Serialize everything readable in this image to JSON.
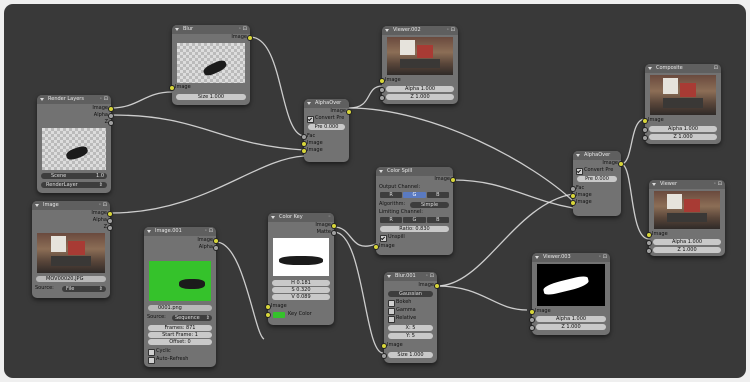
{
  "nodes": {
    "blur_top": {
      "title": "Blur",
      "out_image": "Image",
      "in_image": "Image",
      "size": "Size 1.000"
    },
    "render_layers": {
      "title": "Render Layers",
      "image": "Image",
      "alpha": "Alpha",
      "z": "Z",
      "scene": "Scene",
      "scene_val": "1.0",
      "layer": "RenderLayer"
    },
    "alphaover_1": {
      "title": "AlphaOver",
      "image_out": "Image",
      "convert_pre": "Convert Pre",
      "premul": "Pre 0.000",
      "fac": "Fac",
      "in1": "Image",
      "in2": "Image"
    },
    "viewer_002": {
      "title": "Viewer.002",
      "image": "Image",
      "alpha": "Alpha 1.000",
      "z": "Z 1.000"
    },
    "image_left": {
      "title": "Image",
      "image": "Image",
      "alpha": "Alpha",
      "z": "Z",
      "file": "MOV00020.JPG",
      "source_lbl": "Source:",
      "source_val": "File"
    },
    "image_001": {
      "title": "Image.001",
      "image": "Image",
      "alpha": "Alpha",
      "file": "0001.png",
      "source_lbl": "Source:",
      "source_val": "Sequence",
      "frames": "Frames: 871",
      "start_frame": "Start Frame: 1",
      "offset": "Offset: 0",
      "cyclic": "Cyclic",
      "auto_refresh": "Auto-Refresh"
    },
    "color_key": {
      "title": "Color Key",
      "image_out": "Image",
      "matte": "Matte",
      "h": "H 0.181",
      "s": "S 0.320",
      "v": "V 0.089",
      "image_in": "Image",
      "key_color": "Key Color"
    },
    "color_spill": {
      "title": "Color Spill",
      "image_out": "Image",
      "output_channel": "Output Channel:",
      "channels": [
        "R",
        "G",
        "B"
      ],
      "algorithm_lbl": "Algorithm:",
      "algorithm_val": "Simple",
      "limiting_channel": "Limiting Channel:",
      "ratio": "Ratio: 0.830",
      "unspill": "Unspill",
      "image_in": "Image"
    },
    "blur_001": {
      "title": "Blur.001",
      "image_out": "Image",
      "filter": "Gaussian",
      "bokeh": "Bokeh",
      "gamma": "Gamma",
      "relative": "Relative",
      "x": "X: 5",
      "y": "Y: 5",
      "image_in": "Image",
      "size": "Size 1.000"
    },
    "viewer_003": {
      "title": "Viewer.003",
      "image": "Image",
      "alpha": "Alpha 1.000",
      "z": "Z 1.000"
    },
    "alphaover_2": {
      "title": "AlphaOver",
      "image_out": "Image",
      "convert_pre": "Convert Pre",
      "premul": "Pre 0.000",
      "fac": "Fac",
      "in1": "Image",
      "in2": "Image"
    },
    "composite": {
      "title": "Composite",
      "image": "Image",
      "alpha": "Alpha 1.000",
      "z": "Z 1.000"
    },
    "viewer": {
      "title": "Viewer",
      "image": "Image",
      "alpha": "Alpha 1.000",
      "z": "Z 1.000"
    }
  },
  "colors": {
    "canvas": "#393939",
    "node_body": "#727272",
    "node_header": "#5f5f5f",
    "socket_color": "#d8d63a",
    "socket_value": "#a1a1a1",
    "wire": "#e8e8e8",
    "green_screen": "#35c22b"
  }
}
